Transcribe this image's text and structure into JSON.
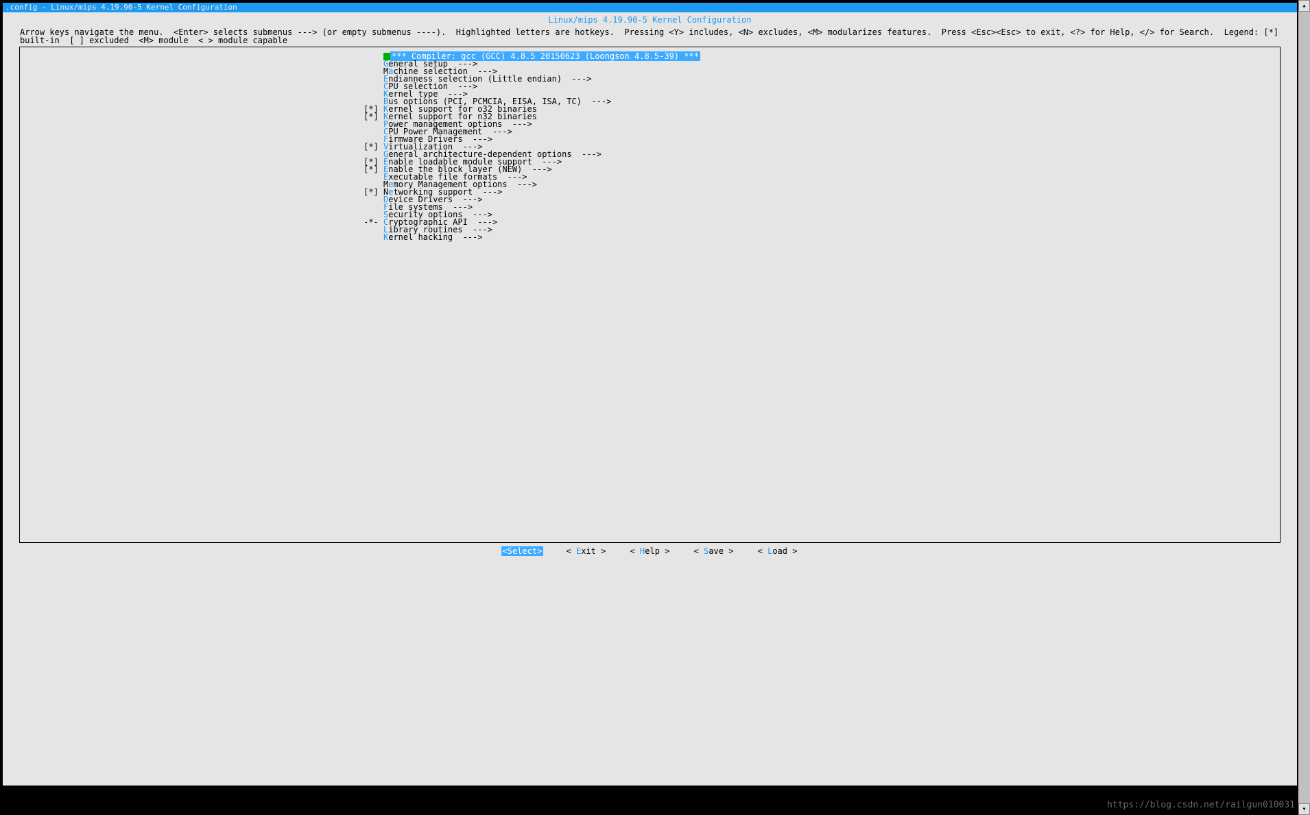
{
  "titlebar": ".config - Linux/mips 4.19.90-5 Kernel Configuration",
  "menu_title": "Linux/mips 4.19.90-5 Kernel Configuration",
  "help_text": "Arrow keys navigate the menu.  <Enter> selects submenus ---> (or empty submenus ----).  Highlighted letters are hotkeys.  Pressing <Y> includes, <N> excludes, <M> modularizes features.  Press <Esc><Esc> to exit, <?> for Help, </> for Search.  Legend: [*] built-in  [ ] excluded  <M> module  < > module capable",
  "items": [
    {
      "prefix": "    ",
      "hot": "",
      "rest": "*** Compiler: gcc (GCC) 4.8.5 20150623 (Loongson 4.8.5-39) ***",
      "highlighted": true
    },
    {
      "prefix": "    ",
      "hot": "G",
      "rest": "eneral setup  --->"
    },
    {
      "prefix": "    ",
      "hot": "",
      "rest": "Machine selection  --->",
      "hotpos": 1,
      "pre": "M",
      "hotc": "a",
      "post": "chine selection  --->"
    },
    {
      "prefix": "    ",
      "hot": "E",
      "rest": "ndianness selection (Little endian)  --->"
    },
    {
      "prefix": "    ",
      "hot": "C",
      "rest": "PU selection  --->"
    },
    {
      "prefix": "    ",
      "hot": "K",
      "rest": "ernel type  --->"
    },
    {
      "prefix": "    ",
      "hot": "B",
      "rest": "us options (PCI, PCMCIA, EISA, ISA, TC)  --->"
    },
    {
      "prefix": "[*] ",
      "hot": "K",
      "rest": "ernel support for o32 binaries"
    },
    {
      "prefix": "[*] ",
      "hot": "K",
      "rest": "ernel support for n32 binaries"
    },
    {
      "prefix": "    ",
      "hot": "P",
      "rest": "ower management options  --->"
    },
    {
      "prefix": "    ",
      "hot": "C",
      "rest": "PU Power Management  --->"
    },
    {
      "prefix": "    ",
      "hot": "F",
      "rest": "irmware Drivers  --->"
    },
    {
      "prefix": "[*] ",
      "hot": "V",
      "rest": "irtualization  --->"
    },
    {
      "prefix": "    ",
      "hot": "G",
      "rest": "eneral architecture-dependent options  --->"
    },
    {
      "prefix": "[*] ",
      "hot": "E",
      "rest": "nable loadable module support  --->"
    },
    {
      "prefix": "[*] ",
      "hot": "E",
      "rest": "nable the block layer (NEW)  --->"
    },
    {
      "prefix": "    ",
      "hot": "E",
      "rest": "xecutable file formats  --->"
    },
    {
      "prefix": "    ",
      "hot": "",
      "rest": "",
      "pre": "M",
      "hotc": "e",
      "post": "mory Management options  --->"
    },
    {
      "prefix": "[*] ",
      "hot": "",
      "rest": "",
      "pre": "N",
      "hotc": "e",
      "post": "tworking support  --->"
    },
    {
      "prefix": "    ",
      "hot": "D",
      "rest": "evice Drivers  --->"
    },
    {
      "prefix": "    ",
      "hot": "F",
      "rest": "ile systems  --->"
    },
    {
      "prefix": "    ",
      "hot": "S",
      "rest": "ecurity options  --->"
    },
    {
      "prefix": "-*- ",
      "hot": "C",
      "rest": "ryptographic API  --->"
    },
    {
      "prefix": "    ",
      "hot": "L",
      "rest": "ibrary routines  --->"
    },
    {
      "prefix": "    ",
      "hot": "K",
      "rest": "ernel hacking  --->"
    }
  ],
  "buttons": {
    "select": "<Select>",
    "exit_pre": "< ",
    "exit_hot": "E",
    "exit_post": "xit >",
    "help_pre": "< ",
    "help_hot": "H",
    "help_post": "elp >",
    "save_pre": "< ",
    "save_hot": "S",
    "save_post": "ave >",
    "load_pre": "< ",
    "load_hot": "L",
    "load_post": "oad >"
  },
  "watermark": "https://blog.csdn.net/railgun010031",
  "scroll_up": "▴",
  "scroll_down": "▾"
}
